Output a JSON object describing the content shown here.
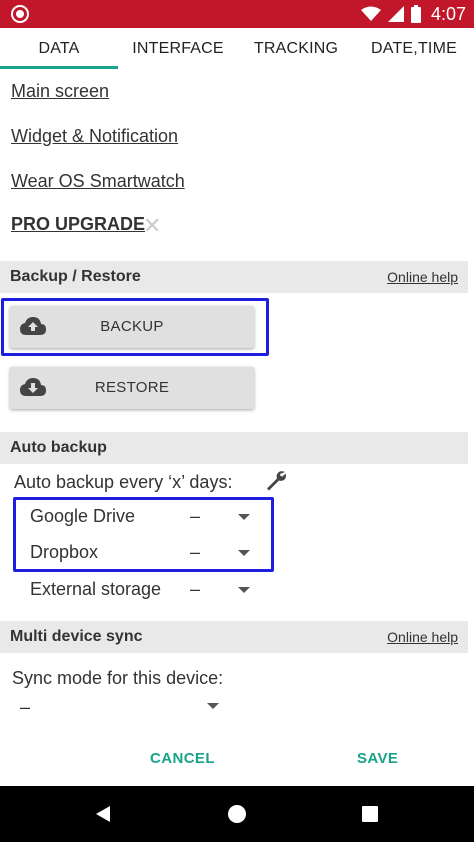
{
  "status_bar": {
    "time": "4:07",
    "icons": [
      "app-record-icon",
      "wifi-icon",
      "signal-icon",
      "battery-icon"
    ]
  },
  "tabs": [
    {
      "label": "DATA",
      "selected": true
    },
    {
      "label": "INTERFACE",
      "selected": false
    },
    {
      "label": "TRACKING",
      "selected": false
    },
    {
      "label": "DATE,TIME",
      "selected": false
    }
  ],
  "links": {
    "main_screen": "Main screen",
    "widget": "Widget & Notification",
    "wear": "Wear OS Smartwatch",
    "pro_upgrade": "PRO UPGRADE",
    "pro_close": "✕"
  },
  "backup_restore": {
    "title": "Backup / Restore",
    "help": "Online help",
    "backup_label": "BACKUP",
    "restore_label": "RESTORE"
  },
  "auto_backup": {
    "title": "Auto backup",
    "every_label": "Auto backup every ‘x’ days:",
    "options": [
      {
        "label": "Google Drive",
        "value": "–"
      },
      {
        "label": "Dropbox",
        "value": "–"
      },
      {
        "label": "External storage",
        "value": "–"
      }
    ]
  },
  "multi_device": {
    "title": "Multi device sync",
    "help": "Online help",
    "sync_label": "Sync mode for this device:",
    "sync_value": "–"
  },
  "actions": {
    "cancel": "CANCEL",
    "save": "SAVE"
  },
  "colors": {
    "status_bar": "#c2162b",
    "accent": "#1aa38b",
    "highlight": "#1d1ee0",
    "section_bg": "#e9e9e9"
  }
}
